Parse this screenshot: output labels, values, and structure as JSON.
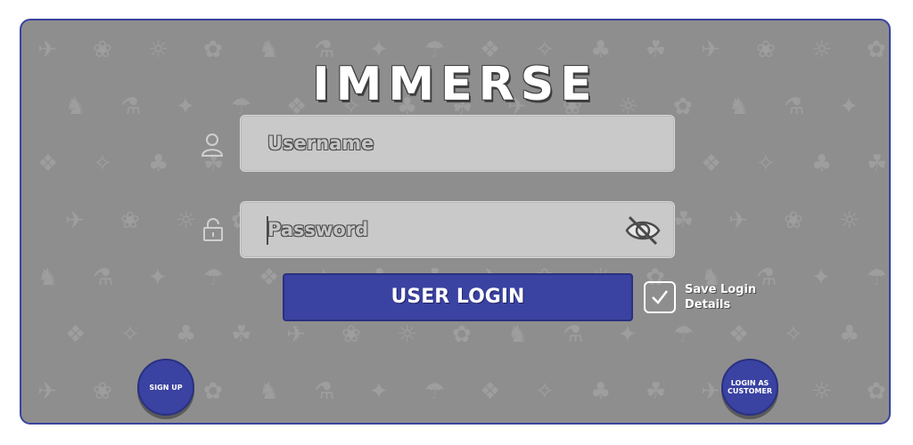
{
  "app": {
    "logo_text": "IMMERSE"
  },
  "form": {
    "username": {
      "placeholder": "Username",
      "icon": "user-icon"
    },
    "password": {
      "placeholder": "Password",
      "icon": "lock-icon",
      "toggle_icon": "eye-slash-icon"
    },
    "login_button_label": "USER LOGIN",
    "save_login": {
      "checked": true,
      "label_line1": "Save Login",
      "label_line2": "Details"
    }
  },
  "footer": {
    "signup_label": "SIGN UP",
    "customer_login_label_line1": "LOGIN AS",
    "customer_login_label_line2": "CUSTOMER"
  },
  "colors": {
    "panel_bg": "#8e8e8e",
    "accent_blue": "#3a42a2",
    "panel_border": "#3a43a0",
    "field_bg": "#c9c9c9"
  }
}
